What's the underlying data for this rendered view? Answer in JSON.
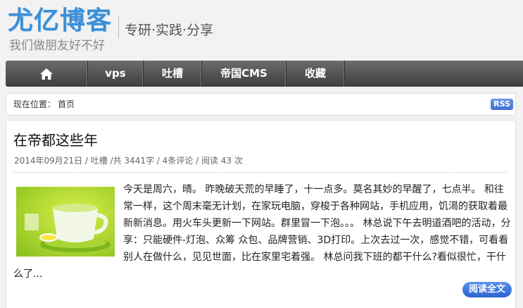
{
  "site": {
    "title": "尤亿博客",
    "motto": "专研·实践·分享",
    "subtitle": "我们做朋友好不好"
  },
  "nav": {
    "home_icon": "home-icon",
    "items": [
      {
        "label": "vps"
      },
      {
        "label": "吐槽"
      },
      {
        "label": "帝国CMS"
      },
      {
        "label": "收藏"
      }
    ]
  },
  "breadcrumb": {
    "label": "现在位置：",
    "home": "首页",
    "rss": "RSS"
  },
  "article": {
    "title": "在帝都这些年",
    "meta": "2014年09月21日 / 吐槽 /共 3441字 / 4条评论 / 阅读 43 次",
    "thumbnail": "green-teacup-image",
    "excerpt": "今天是周六，晴。 昨晚破天荒的早睡了，十一点多。莫名其妙的早醒了，七点半。 和往常一样，这个周末毫无计划，在家玩电脑，穿梭于各种网站，手机应用，饥渴的获取着最新新消息。用火车头更新一下网站。群里冒一下泡。。。 林总说下午去明道酒吧的活动，分享：只能硬件-灯泡、众筹 众包、品牌营销、3D打印。上次去过一次，感觉不错，可看看别人在做什么，见见世面，比在家里宅着强。 林总问我下班的都干什么?看似很忙，干什么了...",
    "read_more": "阅读全文"
  },
  "colors": {
    "brand_blue": "#3b8fd6",
    "nav_dark": "#4a4a4a",
    "button_blue": "#2d64cf"
  }
}
